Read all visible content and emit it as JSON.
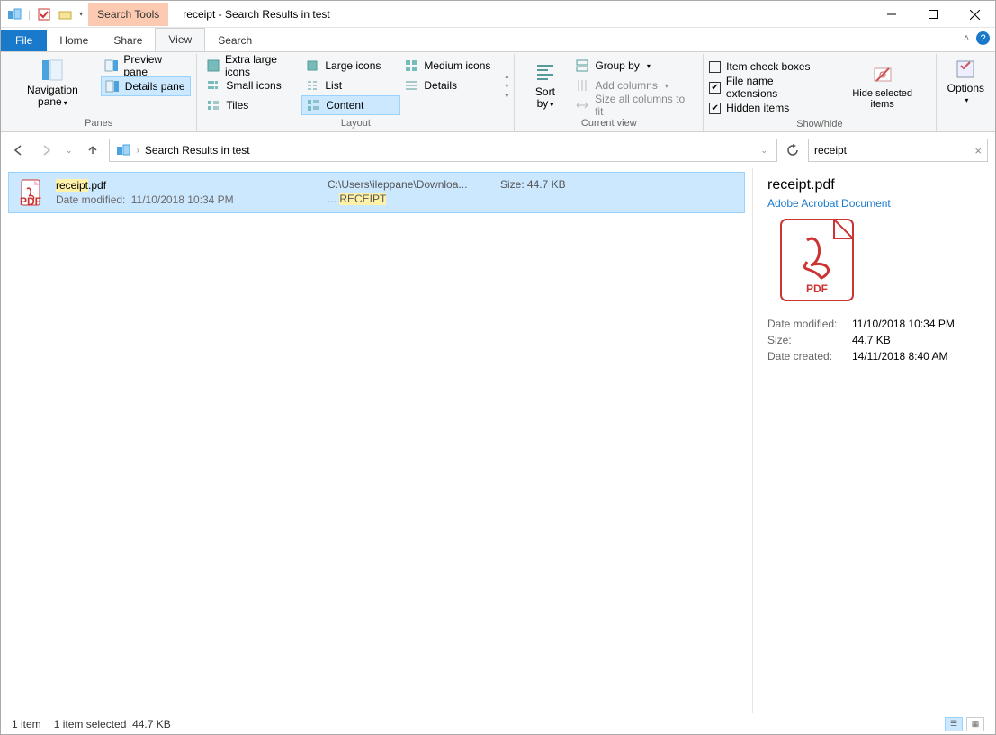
{
  "titlebar": {
    "context_tab": "Search Tools",
    "window_title": "receipt - Search Results in test"
  },
  "tabs": {
    "file": "File",
    "home": "Home",
    "share": "Share",
    "view": "View",
    "search": "Search"
  },
  "ribbon": {
    "panes": {
      "nav": "Navigation pane",
      "preview": "Preview pane",
      "details": "Details pane",
      "group": "Panes"
    },
    "layout": {
      "xl": "Extra large icons",
      "lg": "Large icons",
      "md": "Medium icons",
      "sm": "Small icons",
      "list": "List",
      "details": "Details",
      "tiles": "Tiles",
      "content": "Content",
      "group": "Layout"
    },
    "current_view": {
      "sort": "Sort by",
      "group_by": "Group by",
      "add_cols": "Add columns",
      "size_cols": "Size all columns to fit",
      "group": "Current view"
    },
    "show_hide": {
      "item_cb": "Item check boxes",
      "ext": "File name extensions",
      "hidden": "Hidden items",
      "hide_sel": "Hide selected items",
      "group": "Show/hide"
    },
    "options": "Options"
  },
  "addr": {
    "crumb": "Search Results in test"
  },
  "search": {
    "value": "receipt"
  },
  "result": {
    "title_hl": "receipt",
    "title_ext": ".pdf",
    "mod_label": "Date modified:",
    "mod_value": "11/10/2018 10:34 PM",
    "path": "C:\\Users\\ileppane\\Downloa...",
    "snippet_prefix": "... ",
    "snippet_hl": "RECEIPT",
    "size_label": "Size:",
    "size_value": "44.7 KB"
  },
  "details": {
    "title": "receipt.pdf",
    "type": "Adobe Acrobat Document",
    "meta": [
      {
        "k": "Date modified:",
        "v": "11/10/2018 10:34 PM"
      },
      {
        "k": "Size:",
        "v": "44.7 KB"
      },
      {
        "k": "Date created:",
        "v": "14/11/2018 8:40 AM"
      }
    ]
  },
  "status": {
    "count": "1 item",
    "selected": "1 item selected",
    "size": "44.7 KB"
  }
}
